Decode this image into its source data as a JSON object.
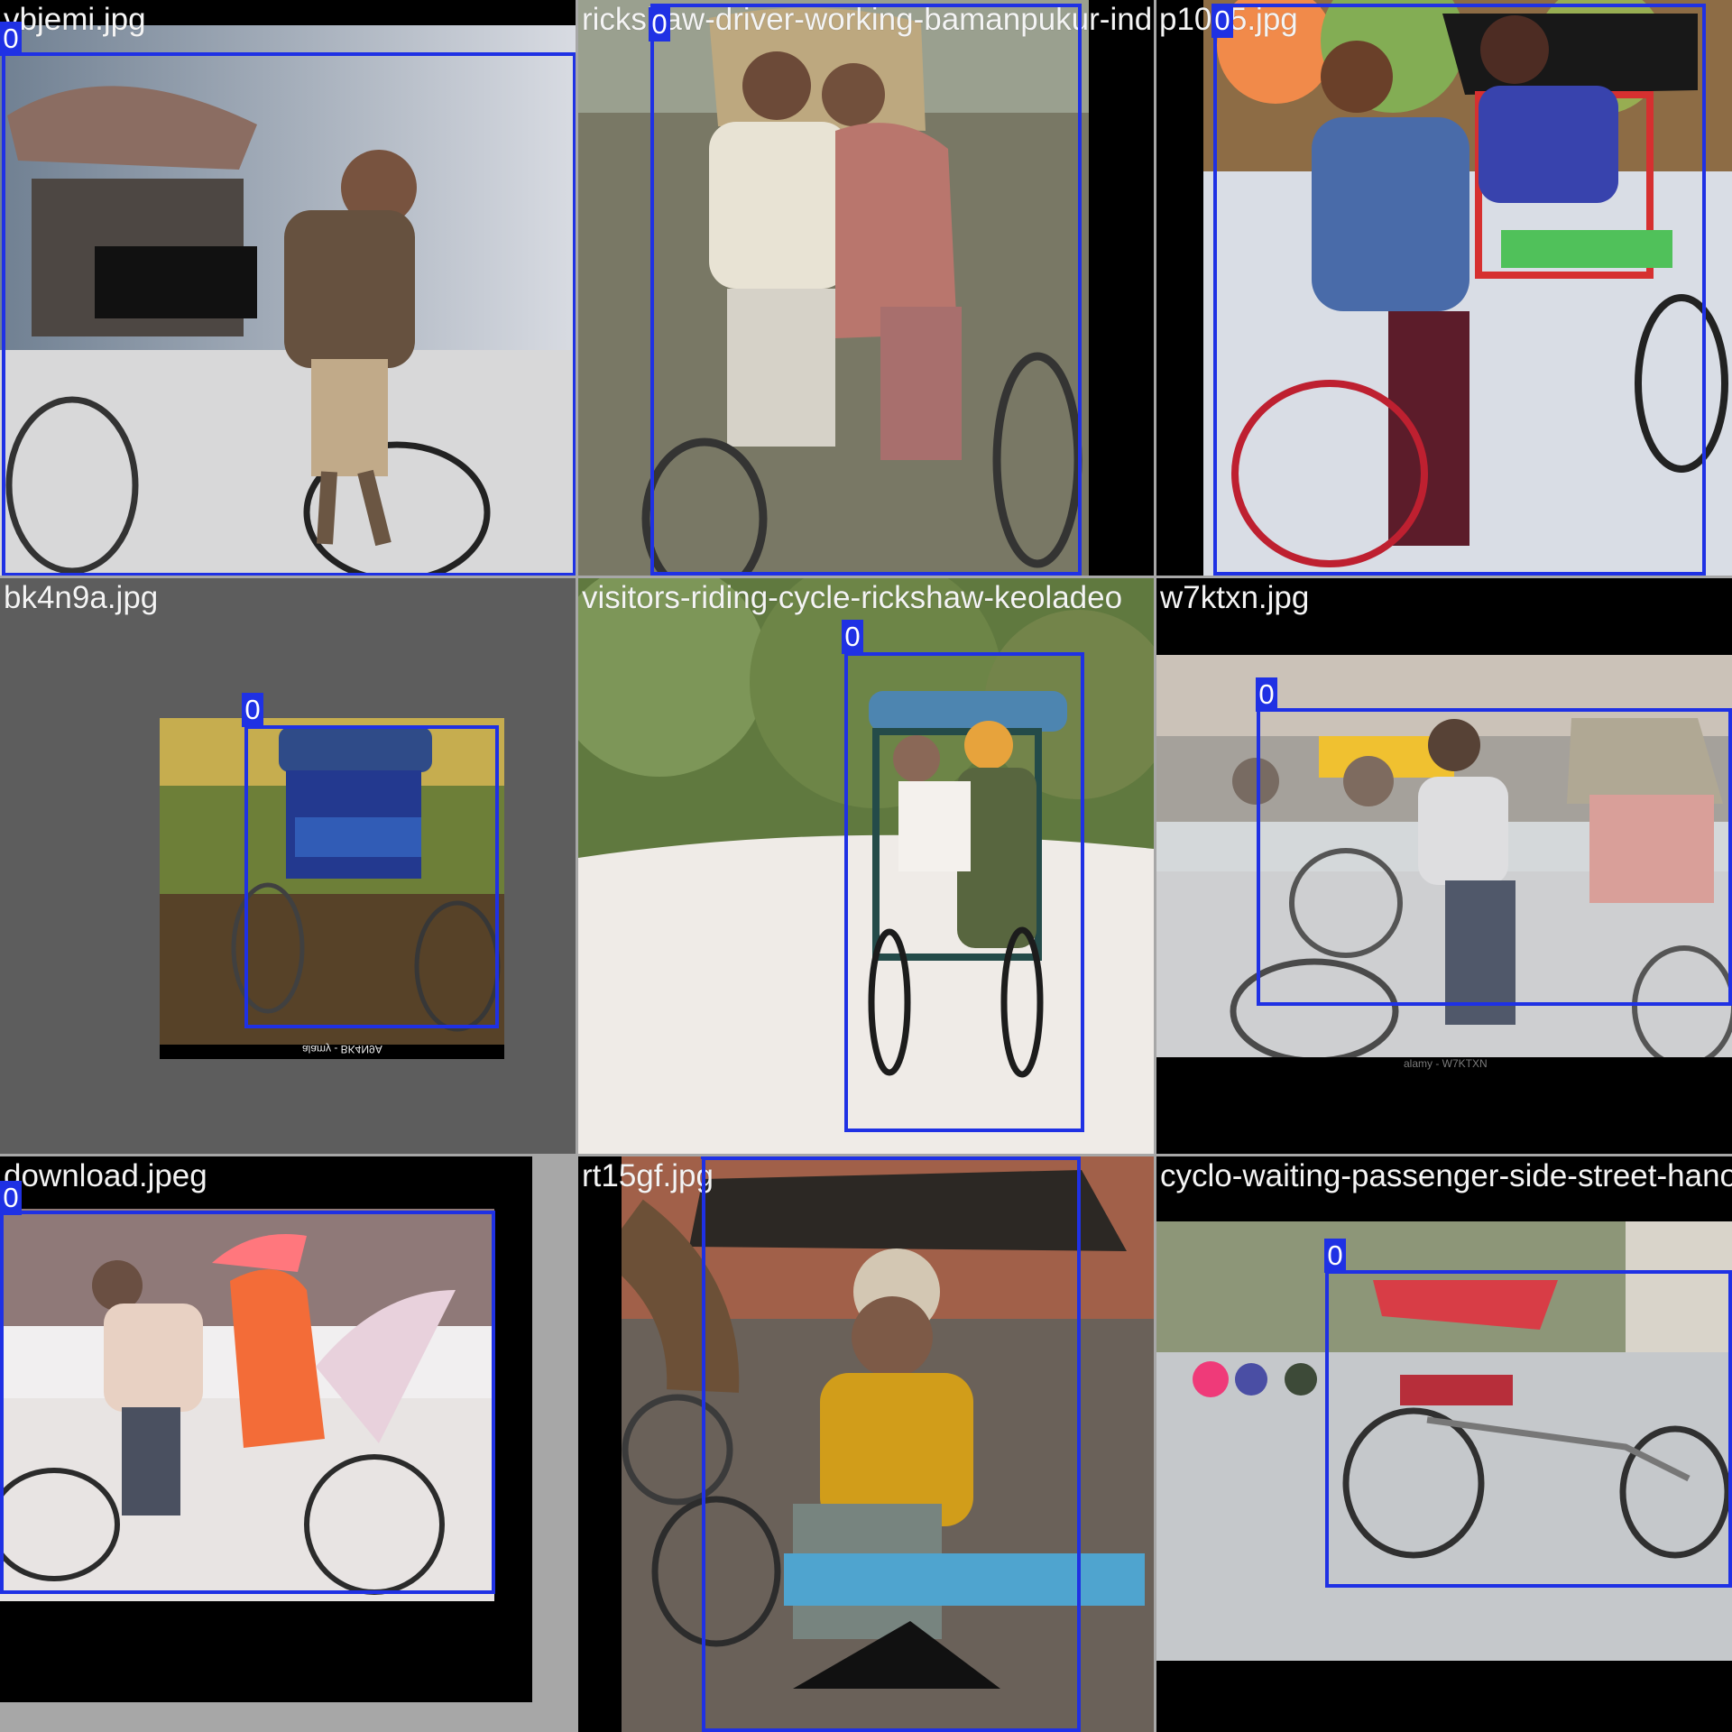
{
  "colors": {
    "box_color": "#1f31e4",
    "label_text_color": "#ffffff",
    "filename_text_color": "#f4f4f4",
    "padding_black": "#000000",
    "padding_gray": "#5d5d5d",
    "background_gray": "#a7a7a7"
  },
  "tiles": [
    {
      "filename": "vbjemi.jpg",
      "class_label": "0",
      "scene": "man riding a cycle rickshaw on a blurred street"
    },
    {
      "filename": "rickshaw-driver-working-bamanpukur-india",
      "class_label": "0",
      "scene": "rickshaw driver with a seated passenger woman"
    },
    {
      "filename": "p1015.jpg",
      "class_label": "0",
      "scene": "smiling man standing beside a red rickshaw with a woman passenger"
    },
    {
      "filename": "bk4n9a.jpg",
      "class_label": "0",
      "scene": "decorated blue rickshaw parked on dry ground",
      "watermark": "alamy - BK4N9A"
    },
    {
      "filename": "visitors-riding-cycle-rickshaw-keoladeo",
      "class_label": "0",
      "scene": "driver in orange turban with photographer passenger"
    },
    {
      "filename": "w7ktxn.jpg",
      "class_label": "0",
      "scene": "rickshaw puller in a busy market street",
      "watermark": "alamy - W7KTXN"
    },
    {
      "filename": "download.jpeg",
      "class_label": "0",
      "scene": "decorated rickshaw with saffron-robed passenger"
    },
    {
      "filename": "rt15gf.jpg",
      "class_label": "0",
      "scene": "elderly man in yellow sweater sitting in a rickshaw"
    },
    {
      "filename": "cyclo-waiting-passenger-side-street-hanoi",
      "class_label": "0",
      "scene": "empty cyclo with red canopy on a rainy street"
    }
  ]
}
